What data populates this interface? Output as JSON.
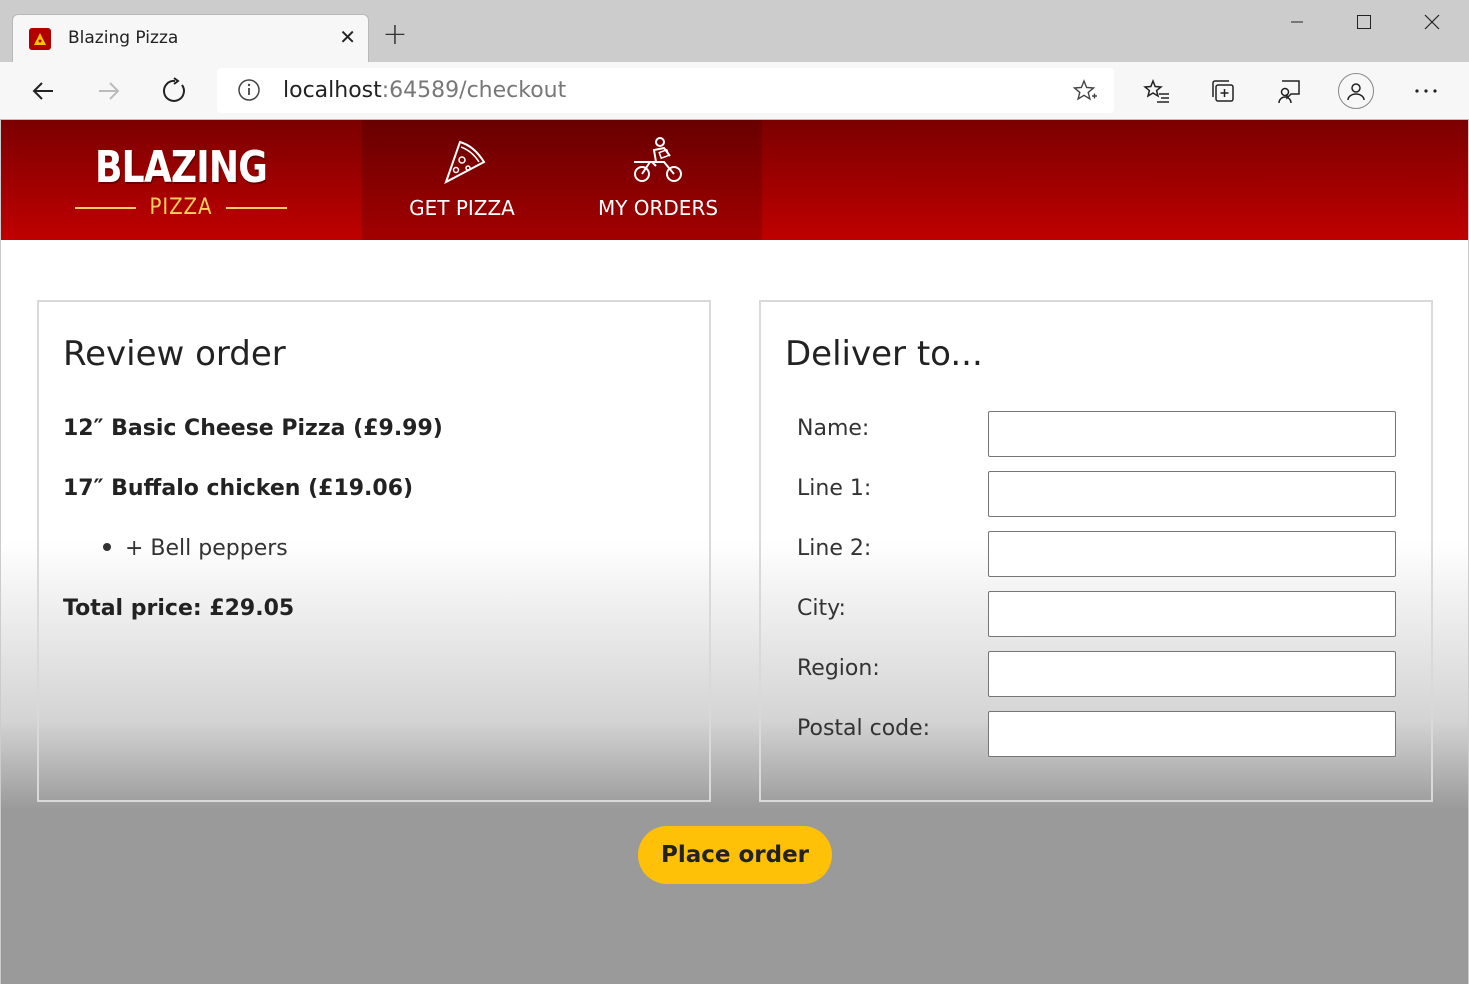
{
  "browser": {
    "tab_title": "Blazing Pizza",
    "tab_close": "✕",
    "new_tab": "+",
    "url_host": "localhost",
    "url_rest": ":64589/checkout"
  },
  "app": {
    "logo_main": "BLAZING",
    "logo_sub": "PIZZA",
    "nav": [
      {
        "label": "GET PIZZA",
        "icon": "pizza-slice-icon"
      },
      {
        "label": "MY ORDERS",
        "icon": "delivery-motorbike-icon"
      }
    ]
  },
  "review": {
    "title": "Review order",
    "items": [
      {
        "text": "12″ Basic Cheese Pizza (£9.99)"
      },
      {
        "text": "17″ Buffalo chicken (£19.06)",
        "toppings": [
          "+ Bell peppers"
        ]
      }
    ],
    "total": "Total price: £29.05"
  },
  "delivery": {
    "title": "Deliver to...",
    "fields": [
      {
        "label": "Name:",
        "value": ""
      },
      {
        "label": "Line 1:",
        "value": ""
      },
      {
        "label": "Line 2:",
        "value": ""
      },
      {
        "label": "City:",
        "value": ""
      },
      {
        "label": "Region:",
        "value": ""
      },
      {
        "label": "Postal code:",
        "value": ""
      }
    ]
  },
  "place_order_label": "Place order",
  "colors": {
    "brand_red": "#c00000",
    "brand_dark_red": "#7b0000",
    "accent_yellow": "#ffc107"
  }
}
